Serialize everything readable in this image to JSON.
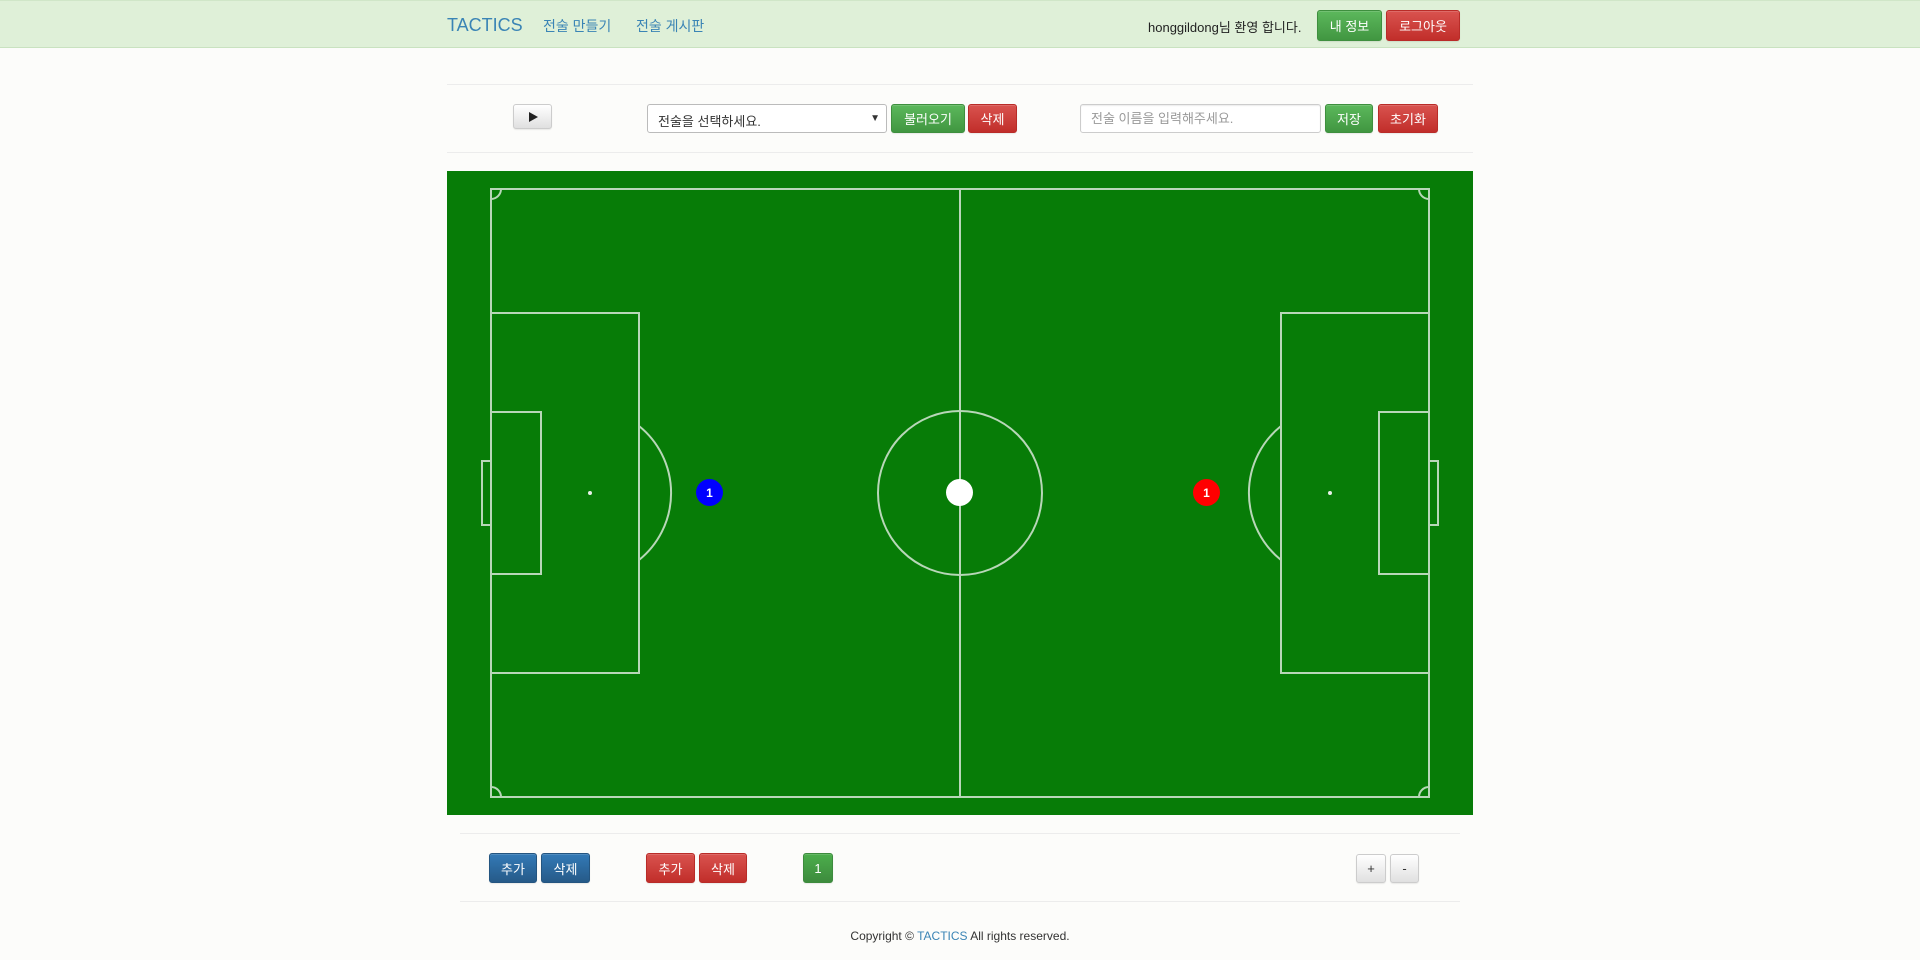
{
  "navbar": {
    "brand": "TACTICS",
    "links": [
      "전술 만들기",
      "전술 게시판"
    ],
    "welcome": "honggildong님 환영 합니다.",
    "my_info_label": "내 정보",
    "logout_label": "로그아웃"
  },
  "toolbar": {
    "play_icon": "play-icon",
    "select_value": "전술을 선택하세요.",
    "load_label": "불러오기",
    "delete_label": "삭제",
    "name_placeholder": "전술 이름을 입력해주세요.",
    "save_label": "저장",
    "reset_label": "초기화"
  },
  "field": {
    "grass_color": "#077c07",
    "blue_player": {
      "number": "1",
      "color": "#0000ff"
    },
    "red_player": {
      "number": "1",
      "color": "#ff0000"
    },
    "ball_color": "#ffffff"
  },
  "controls": {
    "blue_add_label": "추가",
    "blue_delete_label": "삭제",
    "red_add_label": "추가",
    "red_delete_label": "삭제",
    "frame_number": "1",
    "zoom_in_label": "+",
    "zoom_out_label": "-"
  },
  "footer": {
    "prefix": "Copyright ©",
    "brand": "TACTICS",
    "suffix": "All rights reserved."
  }
}
